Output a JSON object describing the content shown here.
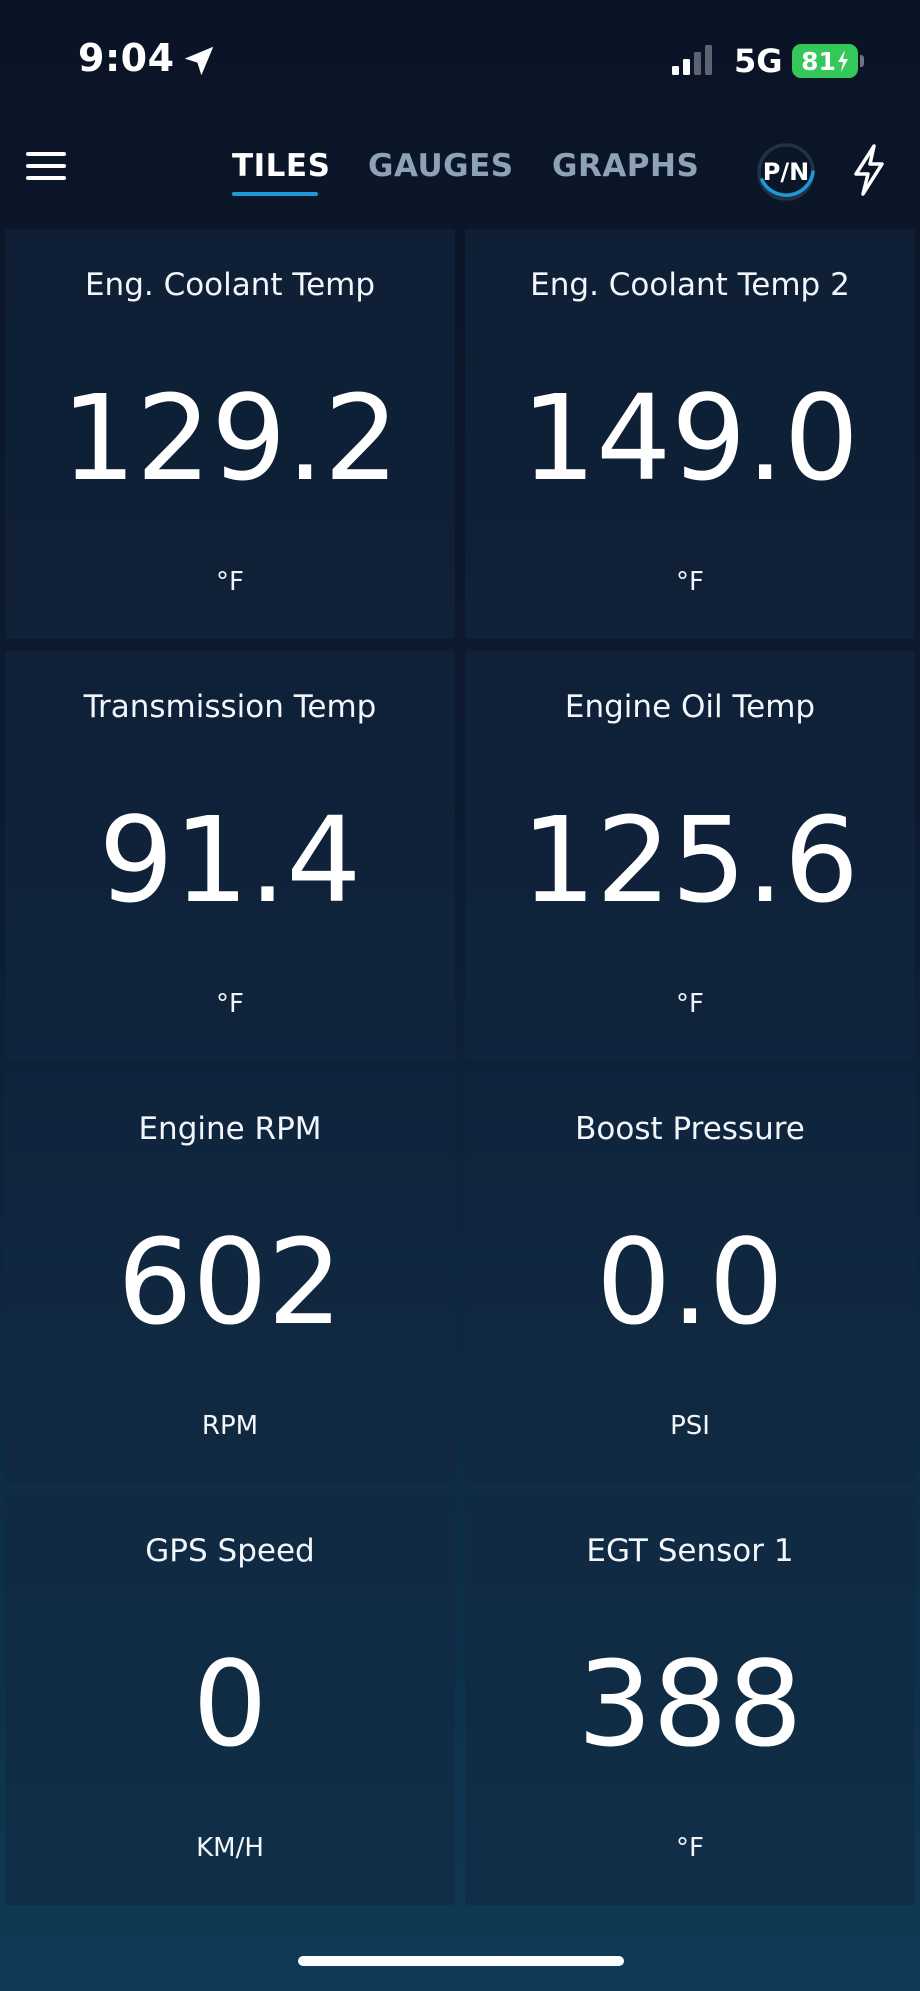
{
  "status_bar": {
    "time": "9:04",
    "network": "5G",
    "battery": "81"
  },
  "header": {
    "tabs": [
      {
        "label": "TILES",
        "active": true
      },
      {
        "label": "GAUGES",
        "active": false
      },
      {
        "label": "GRAPHS",
        "active": false
      }
    ],
    "pn_label": "P/N"
  },
  "tiles": [
    {
      "title": "Eng. Coolant Temp",
      "value": "129.2",
      "unit": "°F"
    },
    {
      "title": "Eng. Coolant Temp 2",
      "value": "149.0",
      "unit": "°F"
    },
    {
      "title": "Transmission Temp",
      "value": "91.4",
      "unit": "°F"
    },
    {
      "title": "Engine Oil Temp",
      "value": "125.6",
      "unit": "°F"
    },
    {
      "title": "Engine RPM",
      "value": "602",
      "unit": "RPM"
    },
    {
      "title": "Boost Pressure",
      "value": "0.0",
      "unit": "PSI"
    },
    {
      "title": "GPS Speed",
      "value": "0",
      "unit": "KM/H"
    },
    {
      "title": "EGT Sensor 1",
      "value": "388",
      "unit": "°F"
    }
  ],
  "colors": {
    "accent": "#1e9ad6",
    "battery": "#34c759",
    "inactive_tab": "#8ea2b5"
  }
}
